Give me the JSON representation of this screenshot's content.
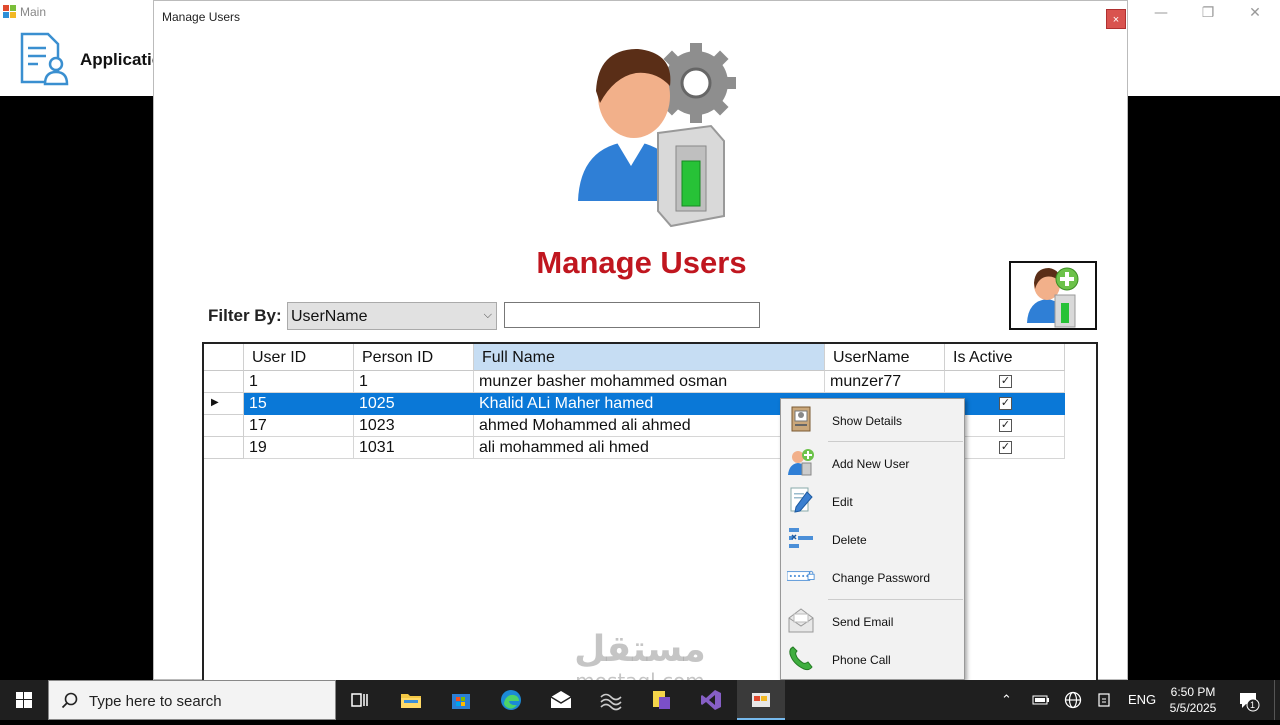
{
  "main_window": {
    "title": "Main",
    "app_title": "Applicatio"
  },
  "dialog": {
    "title": "Manage Users",
    "close_label": "×",
    "heading": "Manage Users"
  },
  "filter": {
    "label": "Filter By:",
    "selected": "UserName",
    "text_value": ""
  },
  "grid": {
    "columns": [
      "User ID",
      "Person ID",
      "Full Name",
      "UserName",
      "Is Active"
    ],
    "rows": [
      {
        "user_id": "1",
        "person_id": "1",
        "full_name": "munzer basher mohammed osman",
        "username": "munzer77",
        "is_active": true
      },
      {
        "user_id": "15",
        "person_id": "1025",
        "full_name": "Khalid ALi Maher hamed",
        "username": "",
        "is_active": true
      },
      {
        "user_id": "17",
        "person_id": "1023",
        "full_name": "ahmed Mohammed ali ahmed",
        "username": "",
        "is_active": true
      },
      {
        "user_id": "19",
        "person_id": "1031",
        "full_name": "ali mohammed ali hmed",
        "username": "",
        "is_active": true
      }
    ],
    "selected_row": 1,
    "selected_column": "Full Name"
  },
  "context_menu": {
    "items": [
      {
        "label": "Show Details",
        "icon": "id-card-icon"
      },
      {
        "label": "Add New User",
        "icon": "add-user-icon"
      },
      {
        "label": "Edit",
        "icon": "edit-icon"
      },
      {
        "label": "Delete",
        "icon": "delete-icon"
      },
      {
        "label": "Change Password",
        "icon": "password-icon"
      },
      {
        "label": "Send Email",
        "icon": "email-icon"
      },
      {
        "label": "Phone Call",
        "icon": "phone-icon"
      }
    ]
  },
  "watermark": {
    "arabic": "مستقل",
    "latin": "mostaql.com"
  },
  "taskbar": {
    "search_placeholder": "Type here to search",
    "language": "ENG",
    "time": "6:50 PM",
    "date": "5/5/2025",
    "notification_count": "1"
  },
  "colors": {
    "heading_red": "#c0161f",
    "selection_blue": "#0a78d7",
    "header_highlight": "#c6ddf3",
    "taskbar": "#1f1f1f"
  }
}
